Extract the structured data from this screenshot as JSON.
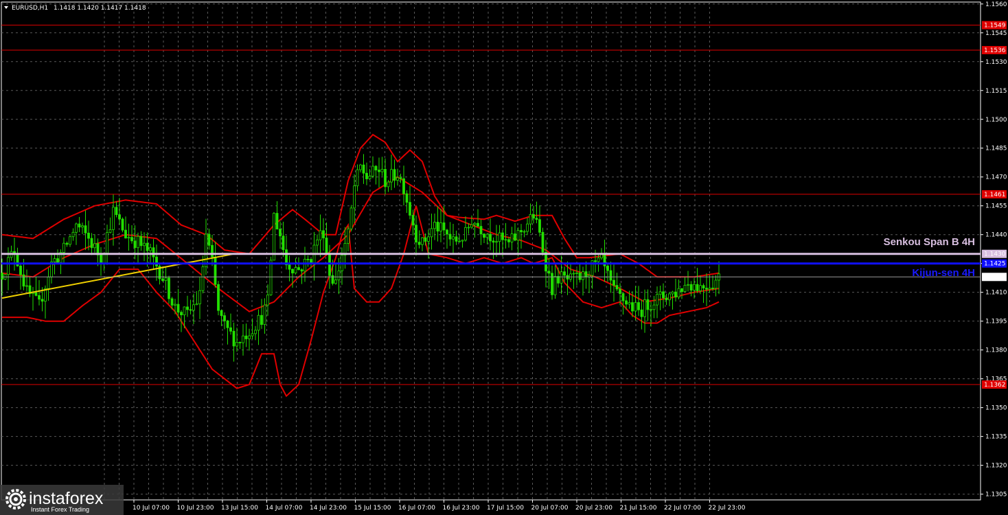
{
  "symbol_header": {
    "symbol": "EURUSD,H1",
    "ohlc": "1.1418 1.1420 1.1417 1.1418"
  },
  "colors": {
    "background": "#000000",
    "grid": "#5a5a5a",
    "candle": "#22e000",
    "bands": "#e00000",
    "levels": "#e00000",
    "kijun": "#1010ff",
    "senkou": "#d8bfe0",
    "trendline": "#f0d000"
  },
  "chart_data": {
    "type": "candlestick",
    "ylim": [
      1.1302,
      1.1561
    ],
    "y_ticks": [
      "1.1560",
      "1.1545",
      "1.1530",
      "1.1515",
      "1.1500",
      "1.1485",
      "1.1470",
      "1.1455",
      "1.1440",
      "1.1425",
      "1.1410",
      "1.1395",
      "1.1380",
      "1.1365",
      "1.1350",
      "1.1335",
      "1.1320",
      "1.1305"
    ],
    "x_ticks": [
      "10 Jul 07:00",
      "10 Jul 23:00",
      "13 Jul 15:00",
      "14 Jul 07:00",
      "14 Jul 23:00",
      "15 Jul 15:00",
      "16 Jul 07:00",
      "16 Jul 23:00",
      "17 Jul 15:00",
      "20 Jul 07:00",
      "20 Jul 23:00",
      "21 Jul 15:00",
      "22 Jul 07:00",
      "22 Jul 23:00"
    ],
    "price_path": [
      [
        0,
        1.142
      ],
      [
        4,
        1.1432
      ],
      [
        8,
        1.141
      ],
      [
        12,
        1.1403
      ],
      [
        16,
        1.1425
      ],
      [
        20,
        1.1432
      ],
      [
        24,
        1.1445
      ],
      [
        28,
        1.1438
      ],
      [
        32,
        1.1428
      ],
      [
        36,
        1.1452
      ],
      [
        40,
        1.144
      ],
      [
        44,
        1.1436
      ],
      [
        48,
        1.143
      ],
      [
        52,
        1.1418
      ],
      [
        56,
        1.1402
      ],
      [
        60,
        1.1398
      ],
      [
        64,
        1.1408
      ],
      [
        66,
        1.144
      ],
      [
        68,
        1.1425
      ],
      [
        70,
        1.14
      ],
      [
        72,
        1.1392
      ],
      [
        76,
        1.1384
      ],
      [
        80,
        1.139
      ],
      [
        84,
        1.1397
      ],
      [
        86,
        1.1405
      ],
      [
        88,
        1.145
      ],
      [
        90,
        1.144
      ],
      [
        92,
        1.1425
      ],
      [
        96,
        1.1422
      ],
      [
        100,
        1.1428
      ],
      [
        102,
        1.1438
      ],
      [
        104,
        1.1442
      ],
      [
        106,
        1.142
      ],
      [
        108,
        1.1415
      ],
      [
        110,
        1.143
      ],
      [
        112,
        1.144
      ],
      [
        114,
        1.1465
      ],
      [
        116,
        1.1475
      ],
      [
        118,
        1.147
      ],
      [
        122,
        1.1474
      ],
      [
        124,
        1.1468
      ],
      [
        128,
        1.1472
      ],
      [
        130,
        1.1465
      ],
      [
        132,
        1.1452
      ],
      [
        134,
        1.144
      ],
      [
        136,
        1.1435
      ],
      [
        140,
        1.1445
      ],
      [
        144,
        1.144
      ],
      [
        146,
        1.1436
      ],
      [
        150,
        1.144
      ],
      [
        152,
        1.1448
      ],
      [
        156,
        1.1442
      ],
      [
        160,
        1.1438
      ],
      [
        164,
        1.1435
      ],
      [
        168,
        1.1442
      ],
      [
        172,
        1.145
      ],
      [
        174,
        1.144
      ],
      [
        176,
        1.1425
      ],
      [
        178,
        1.1412
      ],
      [
        180,
        1.1418
      ],
      [
        184,
        1.1416
      ],
      [
        188,
        1.1418
      ],
      [
        190,
        1.1422
      ],
      [
        194,
        1.1426
      ],
      [
        196,
        1.1418
      ],
      [
        198,
        1.141
      ],
      [
        202,
        1.1405
      ],
      [
        206,
        1.14
      ],
      [
        210,
        1.1405
      ],
      [
        214,
        1.1408
      ],
      [
        218,
        1.141
      ],
      [
        222,
        1.1415
      ],
      [
        226,
        1.1413
      ],
      [
        230,
        1.1415
      ],
      [
        232,
        1.1418
      ]
    ],
    "price_path_units": "hourly bars from 9 Jul 2025, price",
    "band_center": [
      [
        0,
        1.142
      ],
      [
        10,
        1.1418
      ],
      [
        20,
        1.1428
      ],
      [
        30,
        1.1435
      ],
      [
        40,
        1.144
      ],
      [
        50,
        1.1438
      ],
      [
        60,
        1.1425
      ],
      [
        70,
        1.1412
      ],
      [
        80,
        1.14
      ],
      [
        88,
        1.1405
      ],
      [
        96,
        1.1418
      ],
      [
        104,
        1.1428
      ],
      [
        112,
        1.144
      ],
      [
        120,
        1.1462
      ],
      [
        128,
        1.147
      ],
      [
        136,
        1.1462
      ],
      [
        144,
        1.145
      ],
      [
        152,
        1.1445
      ],
      [
        160,
        1.144
      ],
      [
        168,
        1.1437
      ],
      [
        176,
        1.1432
      ],
      [
        184,
        1.1422
      ],
      [
        192,
        1.1418
      ],
      [
        200,
        1.1412
      ],
      [
        208,
        1.1405
      ],
      [
        216,
        1.1407
      ],
      [
        224,
        1.141
      ],
      [
        232,
        1.1412
      ]
    ],
    "band_upper": [
      [
        0,
        1.144
      ],
      [
        10,
        1.1438
      ],
      [
        20,
        1.1448
      ],
      [
        30,
        1.1455
      ],
      [
        40,
        1.1458
      ],
      [
        50,
        1.1456
      ],
      [
        58,
        1.1445
      ],
      [
        66,
        1.144
      ],
      [
        72,
        1.1432
      ],
      [
        80,
        1.143
      ],
      [
        88,
        1.1445
      ],
      [
        94,
        1.1453
      ],
      [
        98,
        1.1448
      ],
      [
        104,
        1.144
      ],
      [
        108,
        1.144
      ],
      [
        112,
        1.1468
      ],
      [
        116,
        1.1485
      ],
      [
        120,
        1.1492
      ],
      [
        124,
        1.1488
      ],
      [
        128,
        1.1478
      ],
      [
        132,
        1.1484
      ],
      [
        136,
        1.1478
      ],
      [
        140,
        1.146
      ],
      [
        144,
        1.145
      ],
      [
        148,
        1.1449
      ],
      [
        156,
        1.1448
      ],
      [
        160,
        1.145
      ],
      [
        166,
        1.1447
      ],
      [
        172,
        1.145
      ],
      [
        178,
        1.145
      ],
      [
        182,
        1.1438
      ],
      [
        186,
        1.1428
      ],
      [
        190,
        1.1428
      ],
      [
        200,
        1.143
      ],
      [
        206,
        1.1425
      ],
      [
        212,
        1.1418
      ],
      [
        218,
        1.1418
      ],
      [
        224,
        1.1418
      ],
      [
        232,
        1.142
      ]
    ],
    "band_lower": [
      [
        0,
        1.1397
      ],
      [
        8,
        1.1397
      ],
      [
        14,
        1.1395
      ],
      [
        20,
        1.1395
      ],
      [
        26,
        1.1403
      ],
      [
        32,
        1.141
      ],
      [
        38,
        1.1422
      ],
      [
        44,
        1.1422
      ],
      [
        50,
        1.141
      ],
      [
        56,
        1.14
      ],
      [
        62,
        1.1385
      ],
      [
        68,
        1.137
      ],
      [
        72,
        1.1365
      ],
      [
        76,
        1.136
      ],
      [
        80,
        1.1362
      ],
      [
        84,
        1.1378
      ],
      [
        88,
        1.1378
      ],
      [
        90,
        1.1362
      ],
      [
        92,
        1.1356
      ],
      [
        96,
        1.1362
      ],
      [
        100,
        1.1385
      ],
      [
        104,
        1.141
      ],
      [
        108,
        1.1428
      ],
      [
        110,
        1.144
      ],
      [
        112,
        1.1445
      ],
      [
        114,
        1.1412
      ],
      [
        118,
        1.1405
      ],
      [
        122,
        1.1405
      ],
      [
        126,
        1.1412
      ],
      [
        130,
        1.143
      ],
      [
        134,
        1.1455
      ],
      [
        138,
        1.143
      ],
      [
        144,
        1.1428
      ],
      [
        150,
        1.1425
      ],
      [
        156,
        1.1428
      ],
      [
        162,
        1.1425
      ],
      [
        168,
        1.1428
      ],
      [
        172,
        1.1425
      ],
      [
        178,
        1.1428
      ],
      [
        182,
        1.1415
      ],
      [
        188,
        1.1405
      ],
      [
        194,
        1.1402
      ],
      [
        200,
        1.1405
      ],
      [
        204,
        1.1398
      ],
      [
        208,
        1.1394
      ],
      [
        212,
        1.1394
      ],
      [
        216,
        1.1398
      ],
      [
        222,
        1.14
      ],
      [
        228,
        1.1402
      ],
      [
        232,
        1.1405
      ]
    ],
    "trendline": {
      "from": [
        0,
        1.1407
      ],
      "to": [
        54,
        1.143
      ]
    },
    "horizontal_levels": [
      {
        "price": "1.1549",
        "label": "1.1549"
      },
      {
        "price": "1.1536",
        "label": "1.1536"
      },
      {
        "price": "1.1461",
        "label": "1.1461"
      },
      {
        "price": "1.1362",
        "label": "1.1362"
      }
    ],
    "ichimoku_lines": [
      {
        "name": "Senkou Span B 4H",
        "price": "1.1430",
        "label": "1.1430"
      },
      {
        "name": "Kijun-sen 4H",
        "price": "1.1425",
        "label": "1.1425"
      }
    ],
    "current_price": "1.1418"
  },
  "labels": {
    "senkou_text": "Senkou Span B 4H",
    "kijun_text": "Kijun-sen 4H"
  },
  "branding": {
    "logo_name": "instaforex",
    "tagline": "Instant Forex Trading"
  }
}
